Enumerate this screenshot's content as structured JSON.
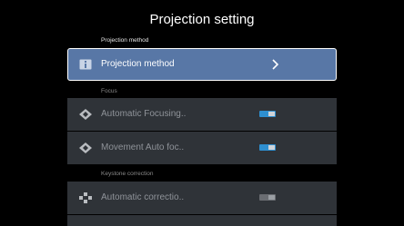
{
  "header": {
    "title": "Projection setting"
  },
  "sections": [
    {
      "label": "Projection method"
    },
    {
      "label": "Focus"
    },
    {
      "label": "Keystone correction"
    }
  ],
  "items": [
    {
      "label": "Projection method",
      "icon": "projector-icon",
      "control": "chevron"
    },
    {
      "label": "Automatic Focusing..",
      "icon": "focus-icon",
      "control": "toggle",
      "state": "on"
    },
    {
      "label": "Movement Auto foc..",
      "icon": "focus-icon",
      "control": "toggle",
      "state": "on"
    },
    {
      "label": "Automatic correctio..",
      "icon": "keystone-icon",
      "control": "toggle",
      "state": "off"
    }
  ],
  "colors": {
    "background": "#000000",
    "item_bg": "#2f3338",
    "selected_bg": "#5877a6",
    "toggle_on": "#2e8fd0",
    "toggle_off": "#6a6d72"
  }
}
